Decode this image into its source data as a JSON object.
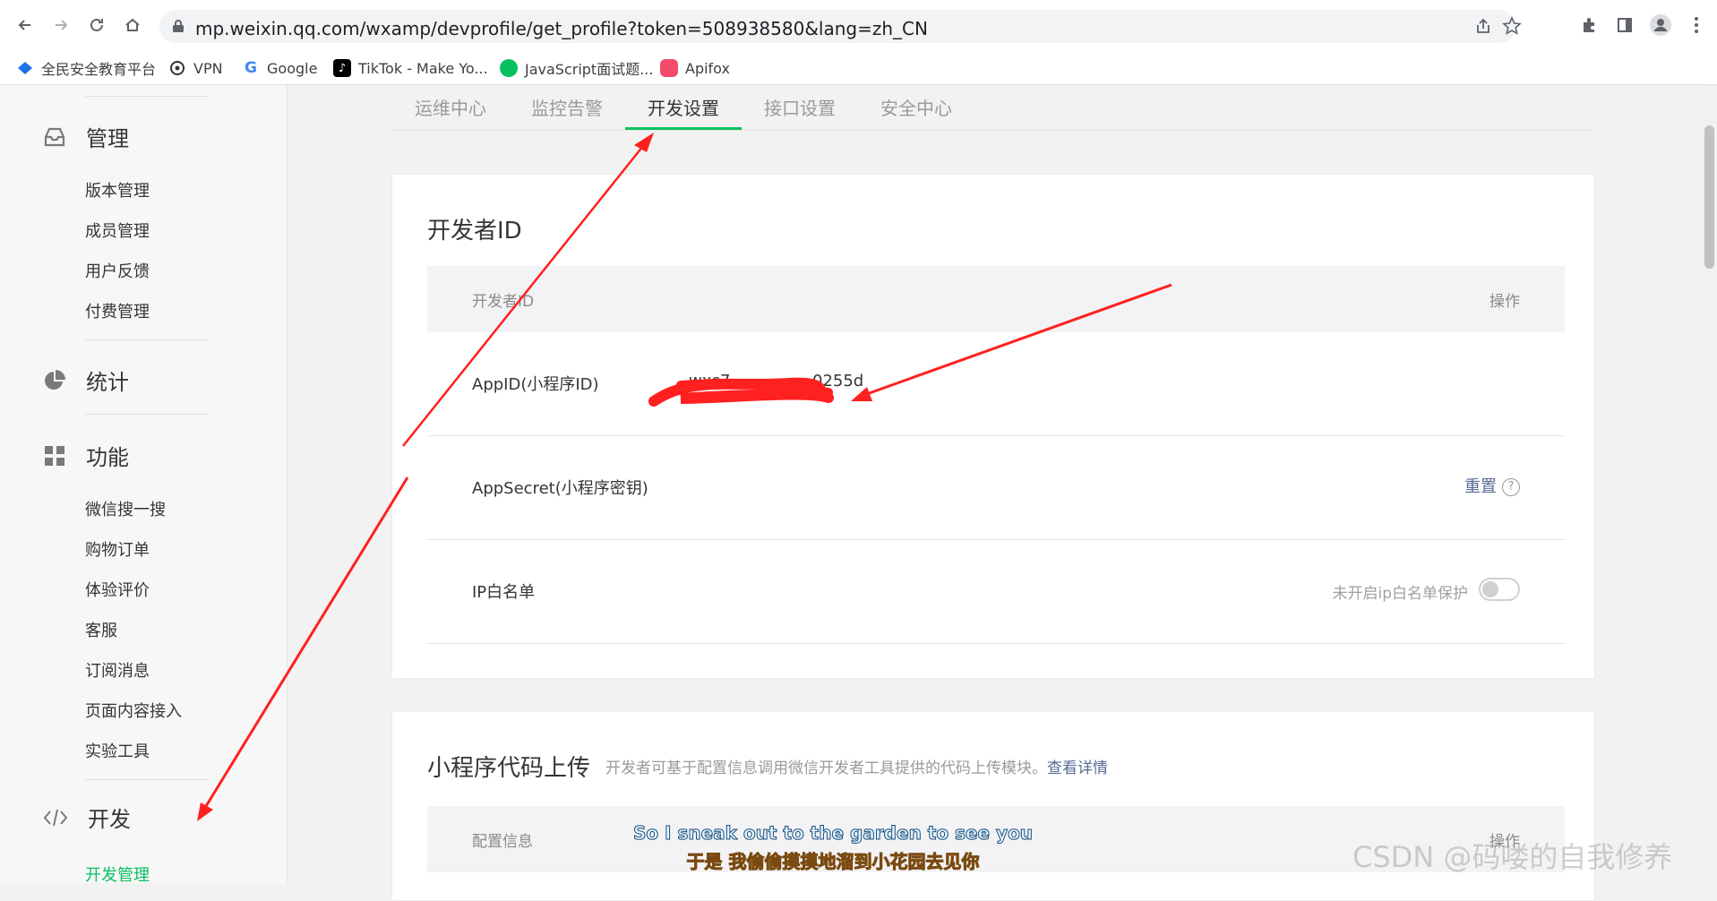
{
  "browser": {
    "url": "mp.weixin.qq.com/wxamp/devprofile/get_profile?token=508938580&lang=zh_CN",
    "bookmarks": [
      {
        "label": "全民安全教育平台",
        "icon": "shield-bookmark-icon",
        "color": "#1a73e8"
      },
      {
        "label": "VPN",
        "icon": "vpn-bookmark-icon",
        "color": "#333333"
      },
      {
        "label": "Google",
        "icon": "google-bookmark-icon",
        "color": "#4285f4"
      },
      {
        "label": "TikTok - Make Yo...",
        "icon": "tiktok-bookmark-icon",
        "color": "#000000"
      },
      {
        "label": "JavaScript面试题...",
        "icon": "wechat-bookmark-icon",
        "color": "#07c160"
      },
      {
        "label": "Apifox",
        "icon": "apifox-bookmark-icon",
        "color": "#f44a6b"
      }
    ]
  },
  "sidebar": {
    "sections": [
      {
        "label": "管理",
        "icon": "inbox-icon",
        "items": [
          "版本管理",
          "成员管理",
          "用户反馈",
          "付费管理"
        ]
      },
      {
        "label": "统计",
        "icon": "pie-chart-icon",
        "items": []
      },
      {
        "label": "功能",
        "icon": "grid-icon",
        "items": [
          "微信搜一搜",
          "购物订单",
          "体验评价",
          "客服",
          "订阅消息",
          "页面内容接入",
          "实验工具"
        ]
      },
      {
        "label": "开发",
        "icon": "code-icon",
        "items": [
          "开发管理"
        ],
        "active_item": "开发管理"
      }
    ]
  },
  "tabs": [
    {
      "label": "运维中心",
      "active": false
    },
    {
      "label": "监控告警",
      "active": false
    },
    {
      "label": "开发设置",
      "active": true
    },
    {
      "label": "接口设置",
      "active": false
    },
    {
      "label": "安全中心",
      "active": false
    }
  ],
  "dev_id_card": {
    "title": "开发者ID",
    "header": {
      "col1": "开发者ID",
      "col2": "操作"
    },
    "rows": [
      {
        "label": "AppID(小程序ID)",
        "value": "wxc7",
        "value_tail": "0255d",
        "action": ""
      },
      {
        "label": "AppSecret(小程序密钥)",
        "value": "",
        "action": "重置"
      },
      {
        "label": "IP白名单",
        "value": "",
        "action": "未开启ip白名单保护",
        "toggle_on": false
      }
    ]
  },
  "upload_card": {
    "title": "小程序代码上传",
    "description": "开发者可基于配置信息调用微信开发者工具提供的代码上传模块。",
    "link": "查看详情",
    "header": {
      "col1": "配置信息",
      "col2": "操作"
    }
  },
  "overlay": {
    "subtitle_en": "So I sneak out to the garden to see you",
    "subtitle_zh": "于是 我偷偷摸摸地溜到小花园去见你",
    "watermark": "CSDN @码喽的自我修养",
    "arrow_color": "#ff2020"
  }
}
